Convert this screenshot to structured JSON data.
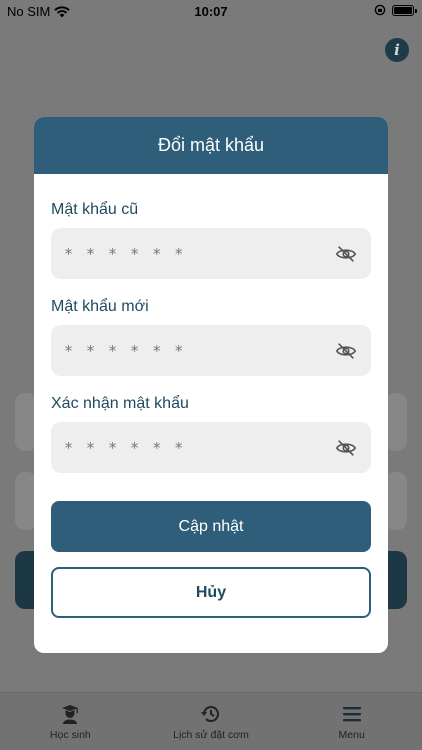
{
  "status_bar": {
    "carrier": "No SIM",
    "time": "10:07"
  },
  "modal": {
    "title": "Đổi mật khẩu",
    "fields": [
      {
        "label": "Mật khẩu cũ",
        "placeholder": "* * * * * *"
      },
      {
        "label": "Mật khẩu mới",
        "placeholder": "* * * * * *"
      },
      {
        "label": "Xác nhận mật khẩu",
        "placeholder": "* * * * * *"
      }
    ],
    "submit_label": "Cập nhật",
    "cancel_label": "Hủy"
  },
  "tabbar": {
    "items": [
      {
        "label": "Học sinh",
        "icon": "student-icon"
      },
      {
        "label": "Lịch sử đặt cơm",
        "icon": "history-icon"
      },
      {
        "label": "Menu",
        "icon": "menu-icon"
      }
    ]
  },
  "colors": {
    "primary": "#2e5e79",
    "overlay": "#7a7a7a",
    "field_bg": "#eeeeee"
  }
}
